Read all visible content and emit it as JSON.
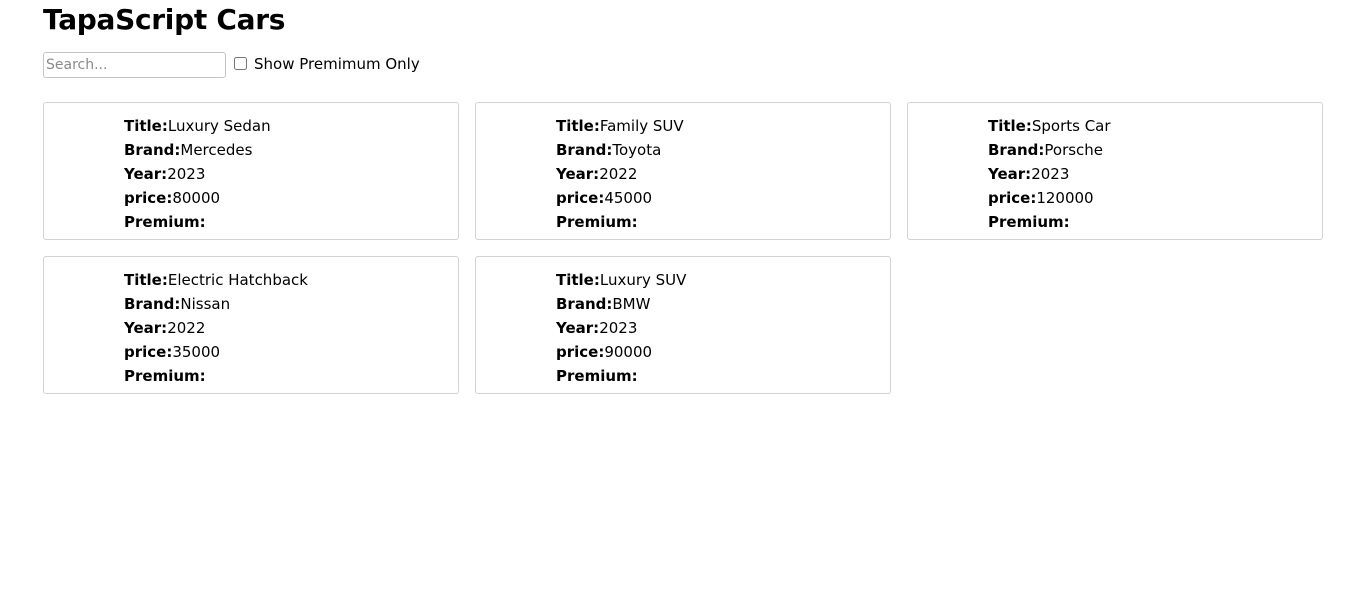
{
  "header": {
    "title": "TapaScript Cars"
  },
  "toolbar": {
    "search_placeholder": "Search...",
    "search_value": "",
    "premium_only_label": "Show Premimum Only",
    "premium_only_checked": false
  },
  "field_labels": {
    "title": "Title:",
    "brand": "Brand:",
    "year": "Year:",
    "price": "price:",
    "premium": "Premium:"
  },
  "cars": [
    {
      "title": "Luxury Sedan",
      "brand": "Mercedes",
      "year": "2023",
      "price": "80000",
      "premium": ""
    },
    {
      "title": "Family SUV",
      "brand": "Toyota",
      "year": "2022",
      "price": "45000",
      "premium": ""
    },
    {
      "title": "Sports Car",
      "brand": "Porsche",
      "year": "2023",
      "price": "120000",
      "premium": ""
    },
    {
      "title": "Electric Hatchback",
      "brand": "Nissan",
      "year": "2022",
      "price": "35000",
      "premium": ""
    },
    {
      "title": "Luxury SUV",
      "brand": "BMW",
      "year": "2023",
      "price": "90000",
      "premium": ""
    }
  ]
}
